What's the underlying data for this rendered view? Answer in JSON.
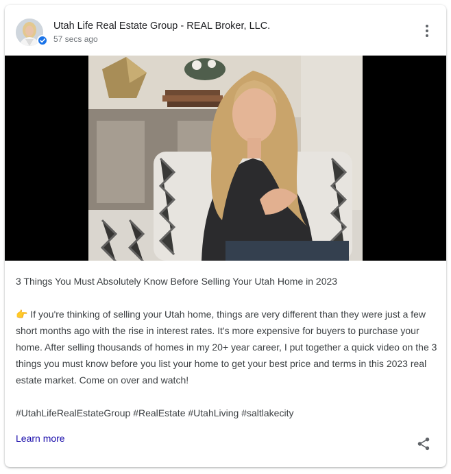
{
  "post": {
    "business_name": "Utah Life Real Estate Group - REAL Broker, LLC.",
    "timestamp": "57 secs ago",
    "title": "3 Things You Must Absolutely Know Before Selling Your Utah Home in 2023",
    "body": "👉 If you're thinking of selling your Utah home, things are very different than they were just a few short months ago with the rise in interest rates. It's more expensive for buyers to purchase your home. After selling thousands of homes in my 20+ year career, I put together a quick video on the 3 things you must know before you list your home to get your best price and terms in this 2023 real estate market. Come on over and watch!",
    "hashtags": "#UtahLifeRealEstateGroup #RealEstate #UtahLiving #saltlakecity",
    "cta_label": "Learn more"
  },
  "icons": {
    "avatar": "profile-photo",
    "verified": "verified-check-icon",
    "more": "more-vert-icon",
    "share": "share-icon"
  },
  "colors": {
    "link": "#1a0dab",
    "verified_badge": "#1a73e8",
    "text": "#3c4043",
    "secondary_text": "#70757a"
  }
}
